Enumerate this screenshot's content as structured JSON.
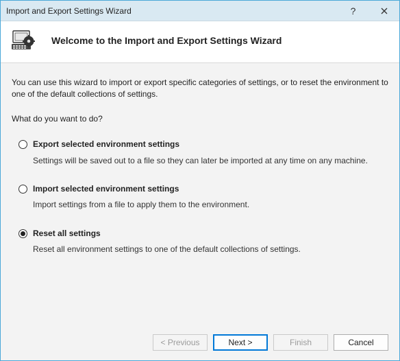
{
  "window": {
    "title": "Import and Export Settings Wizard"
  },
  "header": {
    "heading": "Welcome to the Import and Export Settings Wizard"
  },
  "body": {
    "intro": "You can use this wizard to import or export specific categories of settings, or to reset the environment to one of the default collections of settings.",
    "prompt": "What do you want to do?"
  },
  "options": [
    {
      "id": "export",
      "label": "Export selected environment settings",
      "desc": "Settings will be saved out to a file so they can later be imported at any time on any machine.",
      "selected": false
    },
    {
      "id": "import",
      "label": "Import selected environment settings",
      "desc": "Import settings from a file to apply them to the environment.",
      "selected": false
    },
    {
      "id": "reset",
      "label": "Reset all settings",
      "desc": "Reset all environment settings to one of the default collections of settings.",
      "selected": true
    }
  ],
  "buttons": {
    "previous": "< Previous",
    "next": "Next >",
    "finish": "Finish",
    "cancel": "Cancel"
  }
}
